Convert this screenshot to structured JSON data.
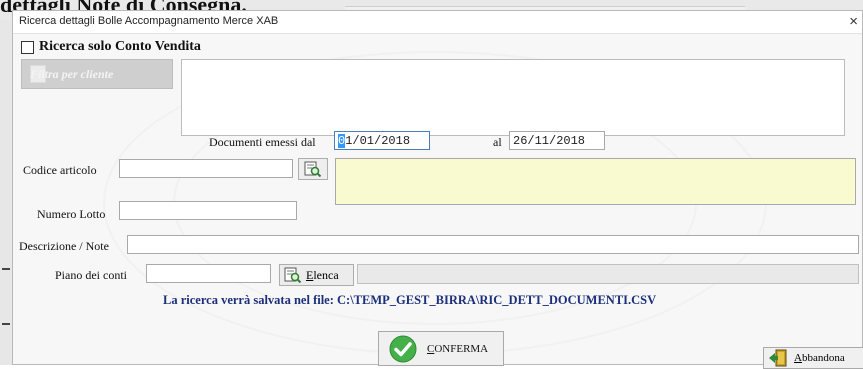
{
  "background": {
    "title": "dettagli Note di Consegna."
  },
  "dialog": {
    "title": "Ricerca dettagli Bolle Accompagnamento Merce XAB",
    "close_glyph": "×",
    "checkbox_label": "Ricerca solo Conto Vendita",
    "filter_button": "Filtra per cliente",
    "docs_from_label": "Documenti emessi dal",
    "date_from_first": "0",
    "date_from_rest": "1/01/2018",
    "docs_to_label": "al",
    "date_to": "26/11/2018",
    "codice_label": "Codice articolo",
    "codice_value": "",
    "lotto_label": "Numero Lotto",
    "lotto_value": "",
    "descr_label": "Descrizione / Note",
    "descr_value": "",
    "piano_label": "Piano dei conti",
    "piano_value": "",
    "elenca_first": "E",
    "elenca_rest": "lenca",
    "save_note": "La ricerca verrà salvata nel file: C:\\TEMP_GEST_BIRRA\\RIC_DETT_DOCUMENTI.CSV",
    "confirm_first": "C",
    "confirm_rest": "ONFERMA",
    "abandon_first": "A",
    "abandon_rest": "bbandona"
  },
  "colors": {
    "note_text": "#1b2f7a",
    "description_area": "#fafad0",
    "confirm_check": "#44b049",
    "selection": "#3399ff"
  },
  "icons": {
    "search_lookup": "magnifier-document-icon",
    "confirm": "check-circle-icon",
    "abandon": "exit-door-icon"
  }
}
